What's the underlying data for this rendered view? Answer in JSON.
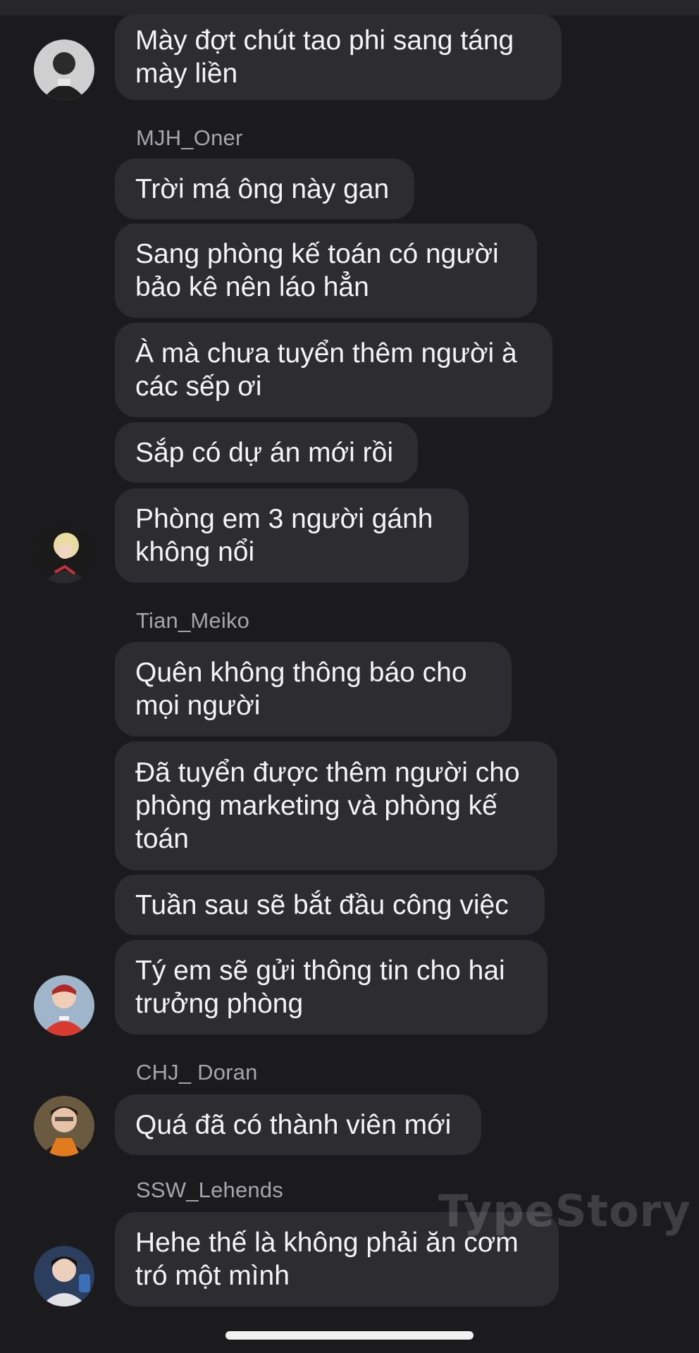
{
  "watermark": "TypeStory",
  "messages": [
    {
      "type": "bubble",
      "text": "Mày đợt chút tao phi sang táng mày liền"
    },
    {
      "type": "sender",
      "text": "MJH_Oner"
    },
    {
      "type": "bubble",
      "text": "Trời má ông này gan"
    },
    {
      "type": "bubble",
      "text": "Sang phòng kế toán có người bảo kê nên láo hẳn"
    },
    {
      "type": "bubble",
      "text": "À mà chưa tuyển thêm người à các sếp ơi"
    },
    {
      "type": "bubble",
      "text": "Sắp có dự án mới rồi"
    },
    {
      "type": "bubble",
      "text": "Phòng em 3 người gánh không nổi"
    },
    {
      "type": "sender",
      "text": "Tian_Meiko"
    },
    {
      "type": "bubble",
      "text": "Quên không thông báo cho mọi người"
    },
    {
      "type": "bubble",
      "text": "Đã tuyển được thêm người cho phòng marketing và phòng kế toán"
    },
    {
      "type": "bubble",
      "text": "Tuần sau sẽ bắt đầu công việc"
    },
    {
      "type": "bubble",
      "text": "Tý em sẽ gửi thông tin cho hai trưởng phòng"
    },
    {
      "type": "sender",
      "text": "CHJ_ Doran"
    },
    {
      "type": "bubble",
      "text": "Quá đã có thành viên mới"
    },
    {
      "type": "sender",
      "text": "SSW_Lehends"
    },
    {
      "type": "bubble",
      "text": "Hehe thế là không phải ăn cơm tró một mình"
    }
  ],
  "avatars": [
    {
      "name": "avatar-top",
      "colors": [
        "#d8d8d8",
        "#2a2a2a"
      ]
    },
    {
      "name": "avatar-mjh-oner",
      "colors": [
        "#e6d8a0",
        "#1a1a1a"
      ]
    },
    {
      "name": "avatar-tian-meiko",
      "colors": [
        "#d94a3a",
        "#e8e8e8"
      ]
    },
    {
      "name": "avatar-chj-doran",
      "colors": [
        "#6b5a3a",
        "#e07020"
      ]
    },
    {
      "name": "avatar-ssw-lehends",
      "colors": [
        "#3c5a8a",
        "#e0e0e0"
      ]
    }
  ]
}
